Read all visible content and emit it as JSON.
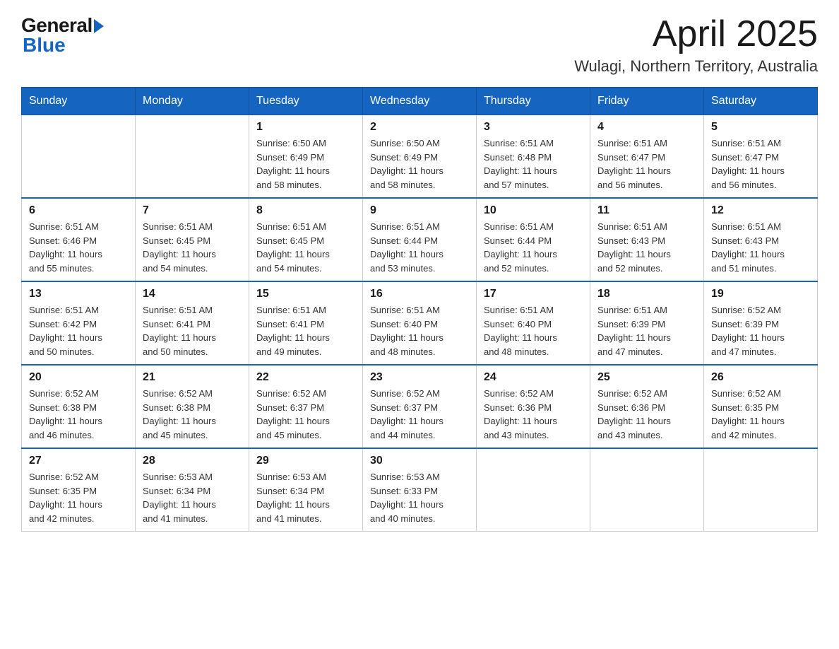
{
  "header": {
    "logo_general": "General",
    "logo_blue": "Blue",
    "month": "April 2025",
    "location": "Wulagi, Northern Territory, Australia"
  },
  "calendar": {
    "days_of_week": [
      "Sunday",
      "Monday",
      "Tuesday",
      "Wednesday",
      "Thursday",
      "Friday",
      "Saturday"
    ],
    "weeks": [
      [
        {
          "day": "",
          "info": ""
        },
        {
          "day": "",
          "info": ""
        },
        {
          "day": "1",
          "info": "Sunrise: 6:50 AM\nSunset: 6:49 PM\nDaylight: 11 hours\nand 58 minutes."
        },
        {
          "day": "2",
          "info": "Sunrise: 6:50 AM\nSunset: 6:49 PM\nDaylight: 11 hours\nand 58 minutes."
        },
        {
          "day": "3",
          "info": "Sunrise: 6:51 AM\nSunset: 6:48 PM\nDaylight: 11 hours\nand 57 minutes."
        },
        {
          "day": "4",
          "info": "Sunrise: 6:51 AM\nSunset: 6:47 PM\nDaylight: 11 hours\nand 56 minutes."
        },
        {
          "day": "5",
          "info": "Sunrise: 6:51 AM\nSunset: 6:47 PM\nDaylight: 11 hours\nand 56 minutes."
        }
      ],
      [
        {
          "day": "6",
          "info": "Sunrise: 6:51 AM\nSunset: 6:46 PM\nDaylight: 11 hours\nand 55 minutes."
        },
        {
          "day": "7",
          "info": "Sunrise: 6:51 AM\nSunset: 6:45 PM\nDaylight: 11 hours\nand 54 minutes."
        },
        {
          "day": "8",
          "info": "Sunrise: 6:51 AM\nSunset: 6:45 PM\nDaylight: 11 hours\nand 54 minutes."
        },
        {
          "day": "9",
          "info": "Sunrise: 6:51 AM\nSunset: 6:44 PM\nDaylight: 11 hours\nand 53 minutes."
        },
        {
          "day": "10",
          "info": "Sunrise: 6:51 AM\nSunset: 6:44 PM\nDaylight: 11 hours\nand 52 minutes."
        },
        {
          "day": "11",
          "info": "Sunrise: 6:51 AM\nSunset: 6:43 PM\nDaylight: 11 hours\nand 52 minutes."
        },
        {
          "day": "12",
          "info": "Sunrise: 6:51 AM\nSunset: 6:43 PM\nDaylight: 11 hours\nand 51 minutes."
        }
      ],
      [
        {
          "day": "13",
          "info": "Sunrise: 6:51 AM\nSunset: 6:42 PM\nDaylight: 11 hours\nand 50 minutes."
        },
        {
          "day": "14",
          "info": "Sunrise: 6:51 AM\nSunset: 6:41 PM\nDaylight: 11 hours\nand 50 minutes."
        },
        {
          "day": "15",
          "info": "Sunrise: 6:51 AM\nSunset: 6:41 PM\nDaylight: 11 hours\nand 49 minutes."
        },
        {
          "day": "16",
          "info": "Sunrise: 6:51 AM\nSunset: 6:40 PM\nDaylight: 11 hours\nand 48 minutes."
        },
        {
          "day": "17",
          "info": "Sunrise: 6:51 AM\nSunset: 6:40 PM\nDaylight: 11 hours\nand 48 minutes."
        },
        {
          "day": "18",
          "info": "Sunrise: 6:51 AM\nSunset: 6:39 PM\nDaylight: 11 hours\nand 47 minutes."
        },
        {
          "day": "19",
          "info": "Sunrise: 6:52 AM\nSunset: 6:39 PM\nDaylight: 11 hours\nand 47 minutes."
        }
      ],
      [
        {
          "day": "20",
          "info": "Sunrise: 6:52 AM\nSunset: 6:38 PM\nDaylight: 11 hours\nand 46 minutes."
        },
        {
          "day": "21",
          "info": "Sunrise: 6:52 AM\nSunset: 6:38 PM\nDaylight: 11 hours\nand 45 minutes."
        },
        {
          "day": "22",
          "info": "Sunrise: 6:52 AM\nSunset: 6:37 PM\nDaylight: 11 hours\nand 45 minutes."
        },
        {
          "day": "23",
          "info": "Sunrise: 6:52 AM\nSunset: 6:37 PM\nDaylight: 11 hours\nand 44 minutes."
        },
        {
          "day": "24",
          "info": "Sunrise: 6:52 AM\nSunset: 6:36 PM\nDaylight: 11 hours\nand 43 minutes."
        },
        {
          "day": "25",
          "info": "Sunrise: 6:52 AM\nSunset: 6:36 PM\nDaylight: 11 hours\nand 43 minutes."
        },
        {
          "day": "26",
          "info": "Sunrise: 6:52 AM\nSunset: 6:35 PM\nDaylight: 11 hours\nand 42 minutes."
        }
      ],
      [
        {
          "day": "27",
          "info": "Sunrise: 6:52 AM\nSunset: 6:35 PM\nDaylight: 11 hours\nand 42 minutes."
        },
        {
          "day": "28",
          "info": "Sunrise: 6:53 AM\nSunset: 6:34 PM\nDaylight: 11 hours\nand 41 minutes."
        },
        {
          "day": "29",
          "info": "Sunrise: 6:53 AM\nSunset: 6:34 PM\nDaylight: 11 hours\nand 41 minutes."
        },
        {
          "day": "30",
          "info": "Sunrise: 6:53 AM\nSunset: 6:33 PM\nDaylight: 11 hours\nand 40 minutes."
        },
        {
          "day": "",
          "info": ""
        },
        {
          "day": "",
          "info": ""
        },
        {
          "day": "",
          "info": ""
        }
      ]
    ]
  }
}
